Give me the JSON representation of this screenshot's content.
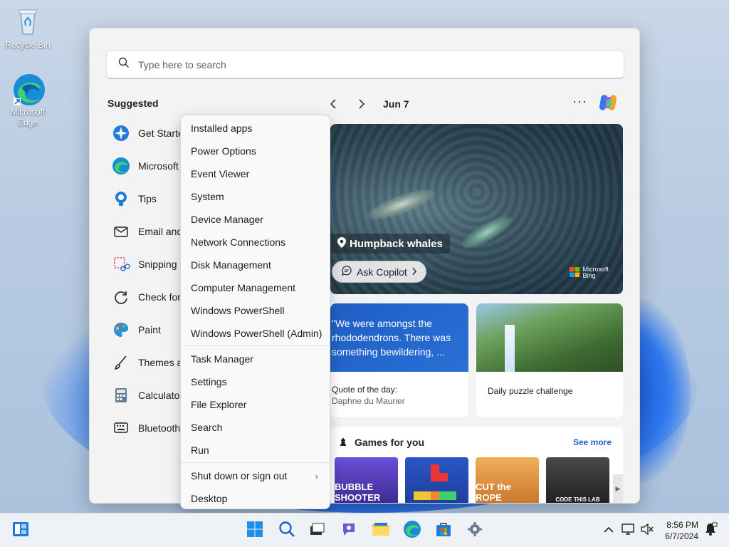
{
  "desktop": {
    "icons": [
      {
        "label": "Recycle Bin",
        "icon": "recycle-bin-icon"
      },
      {
        "label": "Microsoft Edge",
        "icon": "edge-icon"
      }
    ]
  },
  "start_menu": {
    "search": {
      "placeholder": "Type here to search"
    },
    "suggested": {
      "title": "Suggested",
      "items": [
        {
          "label": "Get Starte",
          "icon": "get-started-icon"
        },
        {
          "label": "Microsoft",
          "icon": "edge-icon"
        },
        {
          "label": "Tips",
          "icon": "tips-icon"
        },
        {
          "label": "Email and",
          "icon": "mail-icon"
        },
        {
          "label": "Snipping",
          "icon": "snipping-tool-icon"
        },
        {
          "label": "Check for",
          "icon": "update-icon"
        },
        {
          "label": "Paint",
          "icon": "paint-icon"
        },
        {
          "label": "Themes a",
          "icon": "themes-icon"
        },
        {
          "label": "Calculator",
          "icon": "calculator-icon"
        },
        {
          "label": "Bluetooth",
          "icon": "bluetooth-icon"
        }
      ]
    },
    "feed": {
      "date": "Jun 7",
      "more": "···",
      "hero": {
        "title": "Humpback whales",
        "ask_copilot": "Ask Copilot",
        "bing_line1": "Microsoft",
        "bing_line2": "Bing"
      },
      "quote_card": {
        "text": "\"We were amongst the rhododendrons. There was something bewildering, ...",
        "label": "Quote of the day:",
        "author": "Daphne du Maurier"
      },
      "puzzle_card": {
        "label": "Daily puzzle challenge"
      },
      "games": {
        "title": "Games for you",
        "see_more": "See more",
        "tiles": [
          {
            "label": "BUBBLE SHOOTER",
            "color": "#3b2a8f"
          },
          {
            "label": "",
            "color": "#1d3f9a"
          },
          {
            "label": "CUT the ROPE",
            "color": "#d98a3a"
          },
          {
            "label": "CODE THIS LAB",
            "color": "#2a2a2a"
          }
        ]
      }
    }
  },
  "context_menu": {
    "groups": [
      [
        "Installed apps",
        "Power Options",
        "Event Viewer",
        "System",
        "Device Manager",
        "Network Connections",
        "Disk Management",
        "Computer Management",
        "Windows PowerShell",
        "Windows PowerShell (Admin)"
      ],
      [
        "Task Manager",
        "Settings",
        "File Explorer",
        "Search",
        "Run"
      ],
      [
        "Shut down or sign out",
        "Desktop"
      ]
    ],
    "submenu_indicator": "›"
  },
  "taskbar": {
    "apps": [
      "start-icon",
      "search-icon",
      "task-view-icon",
      "chat-icon",
      "file-explorer-icon",
      "edge-icon",
      "store-icon",
      "settings-icon"
    ],
    "time": "8:56 PM",
    "date": "6/7/2024"
  },
  "colors": {
    "accent": "#1a5fc4",
    "wallpaper_bloom": "#1e63d6",
    "start_bg": "#f3f3f3"
  }
}
